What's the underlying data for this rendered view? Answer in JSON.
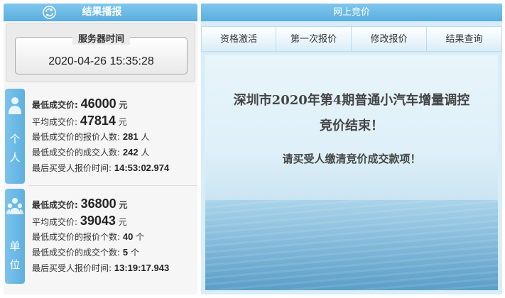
{
  "broadcast": {
    "title": "结果播报",
    "server_label": "服务器时间",
    "server_time": "2020-04-26 15:35:28"
  },
  "personal": {
    "tag": [
      "个",
      "人"
    ],
    "min_price_label": "最低成交价:",
    "min_price": "46000",
    "min_price_unit": "元",
    "avg_price_label": "平均成交价:",
    "avg_price": "47814",
    "avg_price_unit": "元",
    "bidders_label": "最低成交价的报价人数:",
    "bidders": "281",
    "bidders_unit": "人",
    "winners_label": "最低成交价的成交人数:",
    "winners": "242",
    "winners_unit": "人",
    "last_time_label": "最后买受人报价时间:",
    "last_time": "14:53:02.974"
  },
  "unit": {
    "tag": [
      "单",
      "位"
    ],
    "min_price_label": "最低成交价:",
    "min_price": "36800",
    "min_price_unit": "元",
    "avg_price_label": "平均成交价:",
    "avg_price": "39043",
    "avg_price_unit": "元",
    "bidders_label": "最低成交价的报价个数:",
    "bidders": "40",
    "bidders_unit": "个",
    "winners_label": "最低成交价的成交个数:",
    "winners": "5",
    "winners_unit": "个",
    "last_time_label": "最后买受人报价时间:",
    "last_time": "13:19:17.943"
  },
  "auction": {
    "title": "网上竞价",
    "tabs": [
      "资格激活",
      "第一次报价",
      "修改报价",
      "结果查询"
    ],
    "message_line1": "深圳市2020年第4期普通小汽车增量调控",
    "message_line2": "竞价结束！",
    "message_line3": "请买受人缴清竞价成交款项！"
  },
  "colors": {
    "header_blue": "#5aaedd",
    "tag_blue": "#6db9e6"
  },
  "icons": {
    "refresh": "refresh-icon",
    "personal": "person-icon",
    "unit": "group-icon"
  }
}
